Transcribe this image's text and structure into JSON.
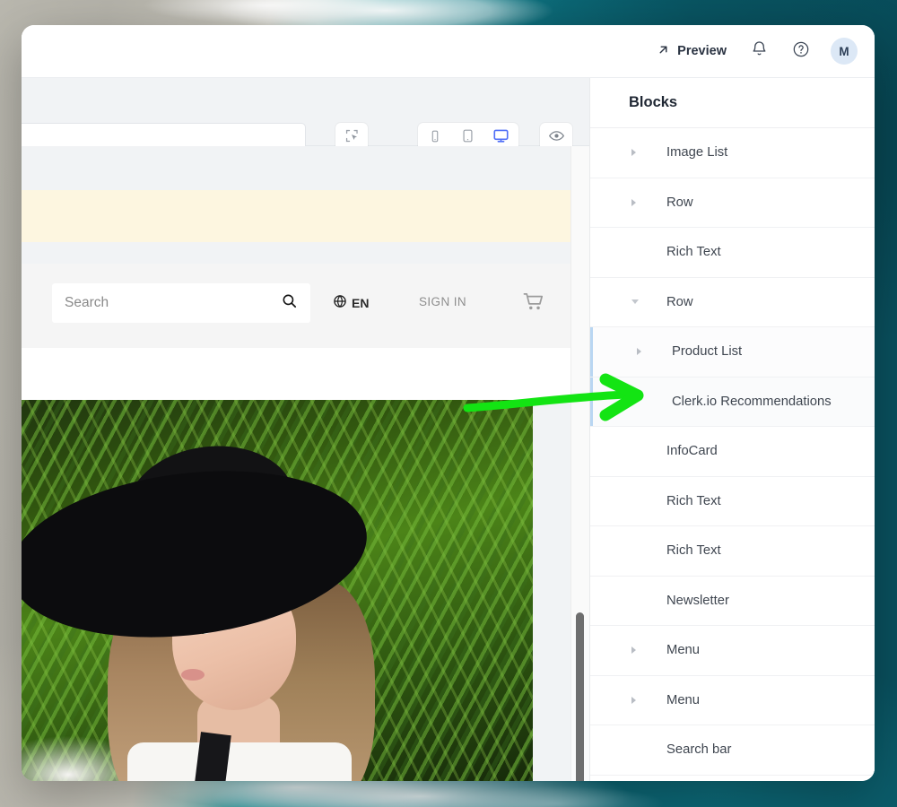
{
  "theme": {
    "accent_blue": "#4f6ef7",
    "highlight_border": "#b9d6f2",
    "annotation_green": "#13e413",
    "avatar_bg": "#dce8f6",
    "banner_yellow": "#fdf6e0",
    "background_teal": "#0a5a68"
  },
  "topbar": {
    "preview_label": "Preview",
    "preview_icon": "arrow-up-right-icon",
    "notifications_icon": "bell-icon",
    "help_icon": "question-circle-icon",
    "avatar_initial": "M"
  },
  "toolbar": {
    "url_value": "",
    "url_placeholder": "",
    "select_tool_icon": "select-box-cursor-icon",
    "devices": [
      {
        "name": "mobile",
        "icon": "mobile-icon",
        "selected": false
      },
      {
        "name": "tablet",
        "icon": "tablet-icon",
        "selected": false
      },
      {
        "name": "desktop",
        "icon": "desktop-icon",
        "selected": true
      }
    ],
    "visibility_icon": "eye-icon"
  },
  "preview": {
    "promo_banner_text": "",
    "search_placeholder": "Search",
    "search_icon": "search-icon",
    "language_icon": "globe-icon",
    "language_label": "EN",
    "signin_label": "SIGN IN",
    "cart_icon": "shopping-cart-icon"
  },
  "blocks_panel": {
    "title": "Blocks",
    "items": [
      {
        "label": "Image List",
        "level": 0,
        "caret": "closed",
        "nested": false,
        "highlighted": false
      },
      {
        "label": "Row",
        "level": 0,
        "caret": "closed",
        "nested": false,
        "highlighted": false
      },
      {
        "label": "Rich Text",
        "level": 0,
        "caret": "none",
        "nested": false,
        "highlighted": false
      },
      {
        "label": "Row",
        "level": 0,
        "caret": "open",
        "nested": false,
        "highlighted": false
      },
      {
        "label": "Product List",
        "level": 1,
        "caret": "closed",
        "nested": true,
        "highlighted": false
      },
      {
        "label": "Clerk.io Recommendations",
        "level": 1,
        "caret": "none",
        "nested": true,
        "highlighted": true
      },
      {
        "label": "InfoCard",
        "level": 0,
        "caret": "none",
        "nested": false,
        "highlighted": false
      },
      {
        "label": "Rich Text",
        "level": 0,
        "caret": "none",
        "nested": false,
        "highlighted": false
      },
      {
        "label": "Rich Text",
        "level": 0,
        "caret": "none",
        "nested": false,
        "highlighted": false
      },
      {
        "label": "Newsletter",
        "level": 0,
        "caret": "none",
        "nested": false,
        "highlighted": false
      },
      {
        "label": "Menu",
        "level": 0,
        "caret": "closed",
        "nested": false,
        "highlighted": false
      },
      {
        "label": "Menu",
        "level": 0,
        "caret": "closed",
        "nested": false,
        "highlighted": false
      },
      {
        "label": "Search bar",
        "level": 0,
        "caret": "none",
        "nested": false,
        "highlighted": false
      }
    ]
  },
  "annotation": {
    "type": "arrow",
    "direction": "right",
    "points_to": "Clerk.io Recommendations"
  }
}
